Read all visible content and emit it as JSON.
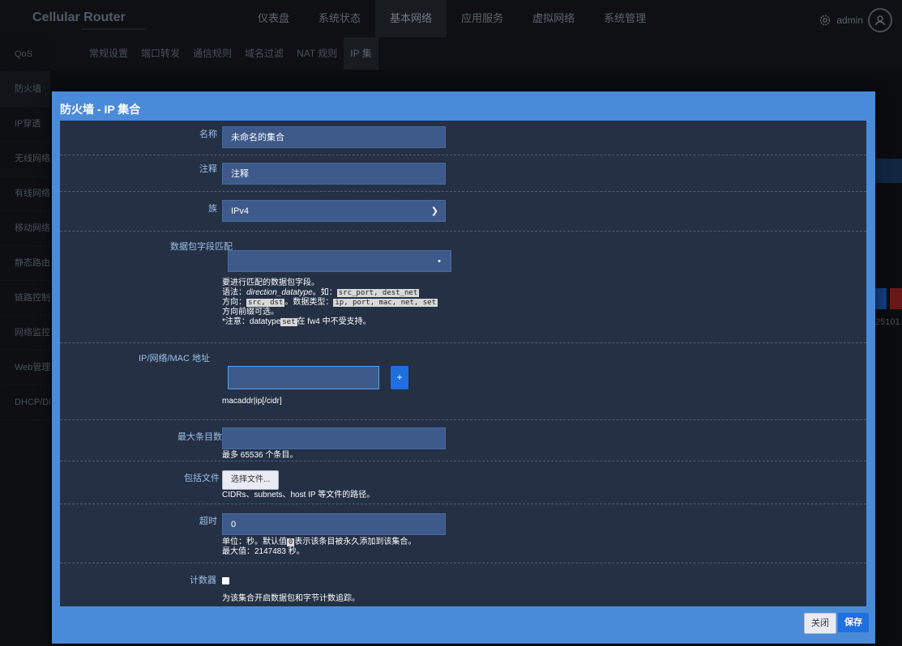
{
  "app": {
    "logo": "Cellular Router",
    "user": "admin"
  },
  "topnav": [
    {
      "label": "仪表盘"
    },
    {
      "label": "系统状态"
    },
    {
      "label": "基本网络",
      "active": true
    },
    {
      "label": "应用服务"
    },
    {
      "label": "虚拟网络"
    },
    {
      "label": "系统管理"
    }
  ],
  "sidebar": [
    {
      "label": "QoS"
    },
    {
      "label": "防火墙",
      "active": true
    },
    {
      "label": "IP穿透"
    },
    {
      "label": "无线网络"
    },
    {
      "label": "有线网络"
    },
    {
      "label": "移动网络"
    },
    {
      "label": "静态路由"
    },
    {
      "label": "链路控制"
    },
    {
      "label": "网络监控"
    },
    {
      "label": "Web管理"
    },
    {
      "label": "DHCP/DI"
    }
  ],
  "subnav": [
    {
      "label": "常规设置"
    },
    {
      "label": "端口转发"
    },
    {
      "label": "通信规则"
    },
    {
      "label": "域名过滤"
    },
    {
      "label": "NAT 规则"
    },
    {
      "label": "IP 集",
      "active": true
    }
  ],
  "background": {
    "number_fragment": "25101"
  },
  "modal": {
    "title": "防火墙 - IP 集合",
    "fields": {
      "name": {
        "label": "名称",
        "value": "未命名的集合"
      },
      "comment": {
        "label": "注释",
        "value": "注释"
      },
      "family": {
        "label": "族",
        "value": "IPv4"
      },
      "match": {
        "label": "数据包字段匹配",
        "value": "",
        "help": {
          "line1": "要进行匹配的数据包字段。",
          "line2_prefix": "语法：",
          "line2_italic": "direction_datatype",
          "line2_mid": "。如：",
          "line2_code": "src_port, dest_net",
          "line3_prefix": "方向：",
          "line3_code1": "src, dst",
          "line3_mid": "。数据类型：",
          "line3_code2": "ip, port, mac, net, set",
          "line4": "方向前缀可选。",
          "line5_prefix": "*注意：datatype",
          "line5_code": "set",
          "line5_suffix": "在 fw4 中不受支持。"
        }
      },
      "address": {
        "label": "IP/网络/MAC 地址",
        "value": "",
        "add": "+",
        "help": "macaddr|ip[/cidr]"
      },
      "maxelem": {
        "label": "最大条目数",
        "value": "",
        "help": "最多 65536 个条目。"
      },
      "include": {
        "label": "包括文件",
        "button": "选择文件...",
        "help": "CIDRs、subnets、host IP 等文件的路径。"
      },
      "timeout": {
        "label": "超时",
        "value": "0",
        "help_prefix": "单位：秒。默认值",
        "help_code": "0",
        "help_suffix": "表示该条目被永久添加到该集合。",
        "help2": "最大值：2147483 秒。"
      },
      "counters": {
        "label": "计数器",
        "checked": false,
        "help": "为该集合开启数据包和字节计数追踪。"
      }
    },
    "footer": {
      "close": "关闭",
      "save": "保存"
    }
  }
}
